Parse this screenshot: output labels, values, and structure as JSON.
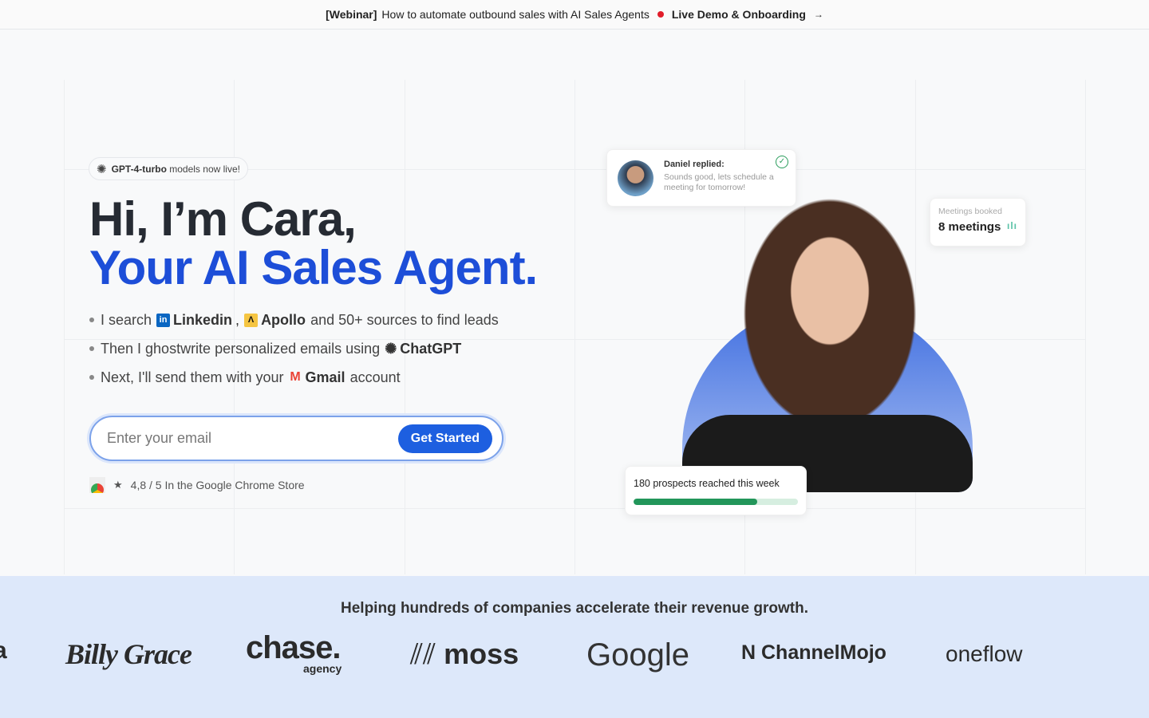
{
  "banner": {
    "tag": "[Webinar]",
    "text": "How to automate outbound sales with AI Sales Agents",
    "link": "Live Demo & Onboarding",
    "arrow": "→"
  },
  "badge": {
    "icon": "openai-icon",
    "bold": "GPT-4-turbo",
    "text": "models now live!"
  },
  "hero": {
    "line1": "Hi, I’m Cara,",
    "line2": "Your AI Sales Agent."
  },
  "bullets": [
    {
      "pre": "I search",
      "b1": "Linkedin",
      "sep": ",",
      "b2": "Apollo",
      "post": "and 50+ sources to find leads"
    },
    {
      "pre": "Then I ghostwrite personalized emails using",
      "b1": "ChatGPT"
    },
    {
      "pre": "Next, I'll send them with your",
      "b1": "Gmail",
      "post": "account"
    }
  ],
  "form": {
    "placeholder": "Enter your email",
    "button": "Get Started"
  },
  "rating": {
    "text": "4,8 / 5 In the Google Chrome Store"
  },
  "cards": {
    "reply": {
      "name": "Daniel replied:",
      "message": "Sounds good, lets schedule a meeting for tomorrow!"
    },
    "meetings": {
      "label": "Meetings booked",
      "value": "8 meetings"
    },
    "prospects": {
      "text": "180 prospects reached this week",
      "progress_percent": 75
    }
  },
  "colors": {
    "accent": "#1d4ed8",
    "button": "#1d5fe0",
    "progress": "#22965a",
    "logo_band": "#dde8fa"
  },
  "logos": {
    "heading": "Helping hundreds of companies accelerate their revenue growth.",
    "items": [
      "Billy Grace",
      "chase.",
      "agency",
      "moss",
      "Google",
      "ChannelMojo",
      "oneflow"
    ]
  }
}
